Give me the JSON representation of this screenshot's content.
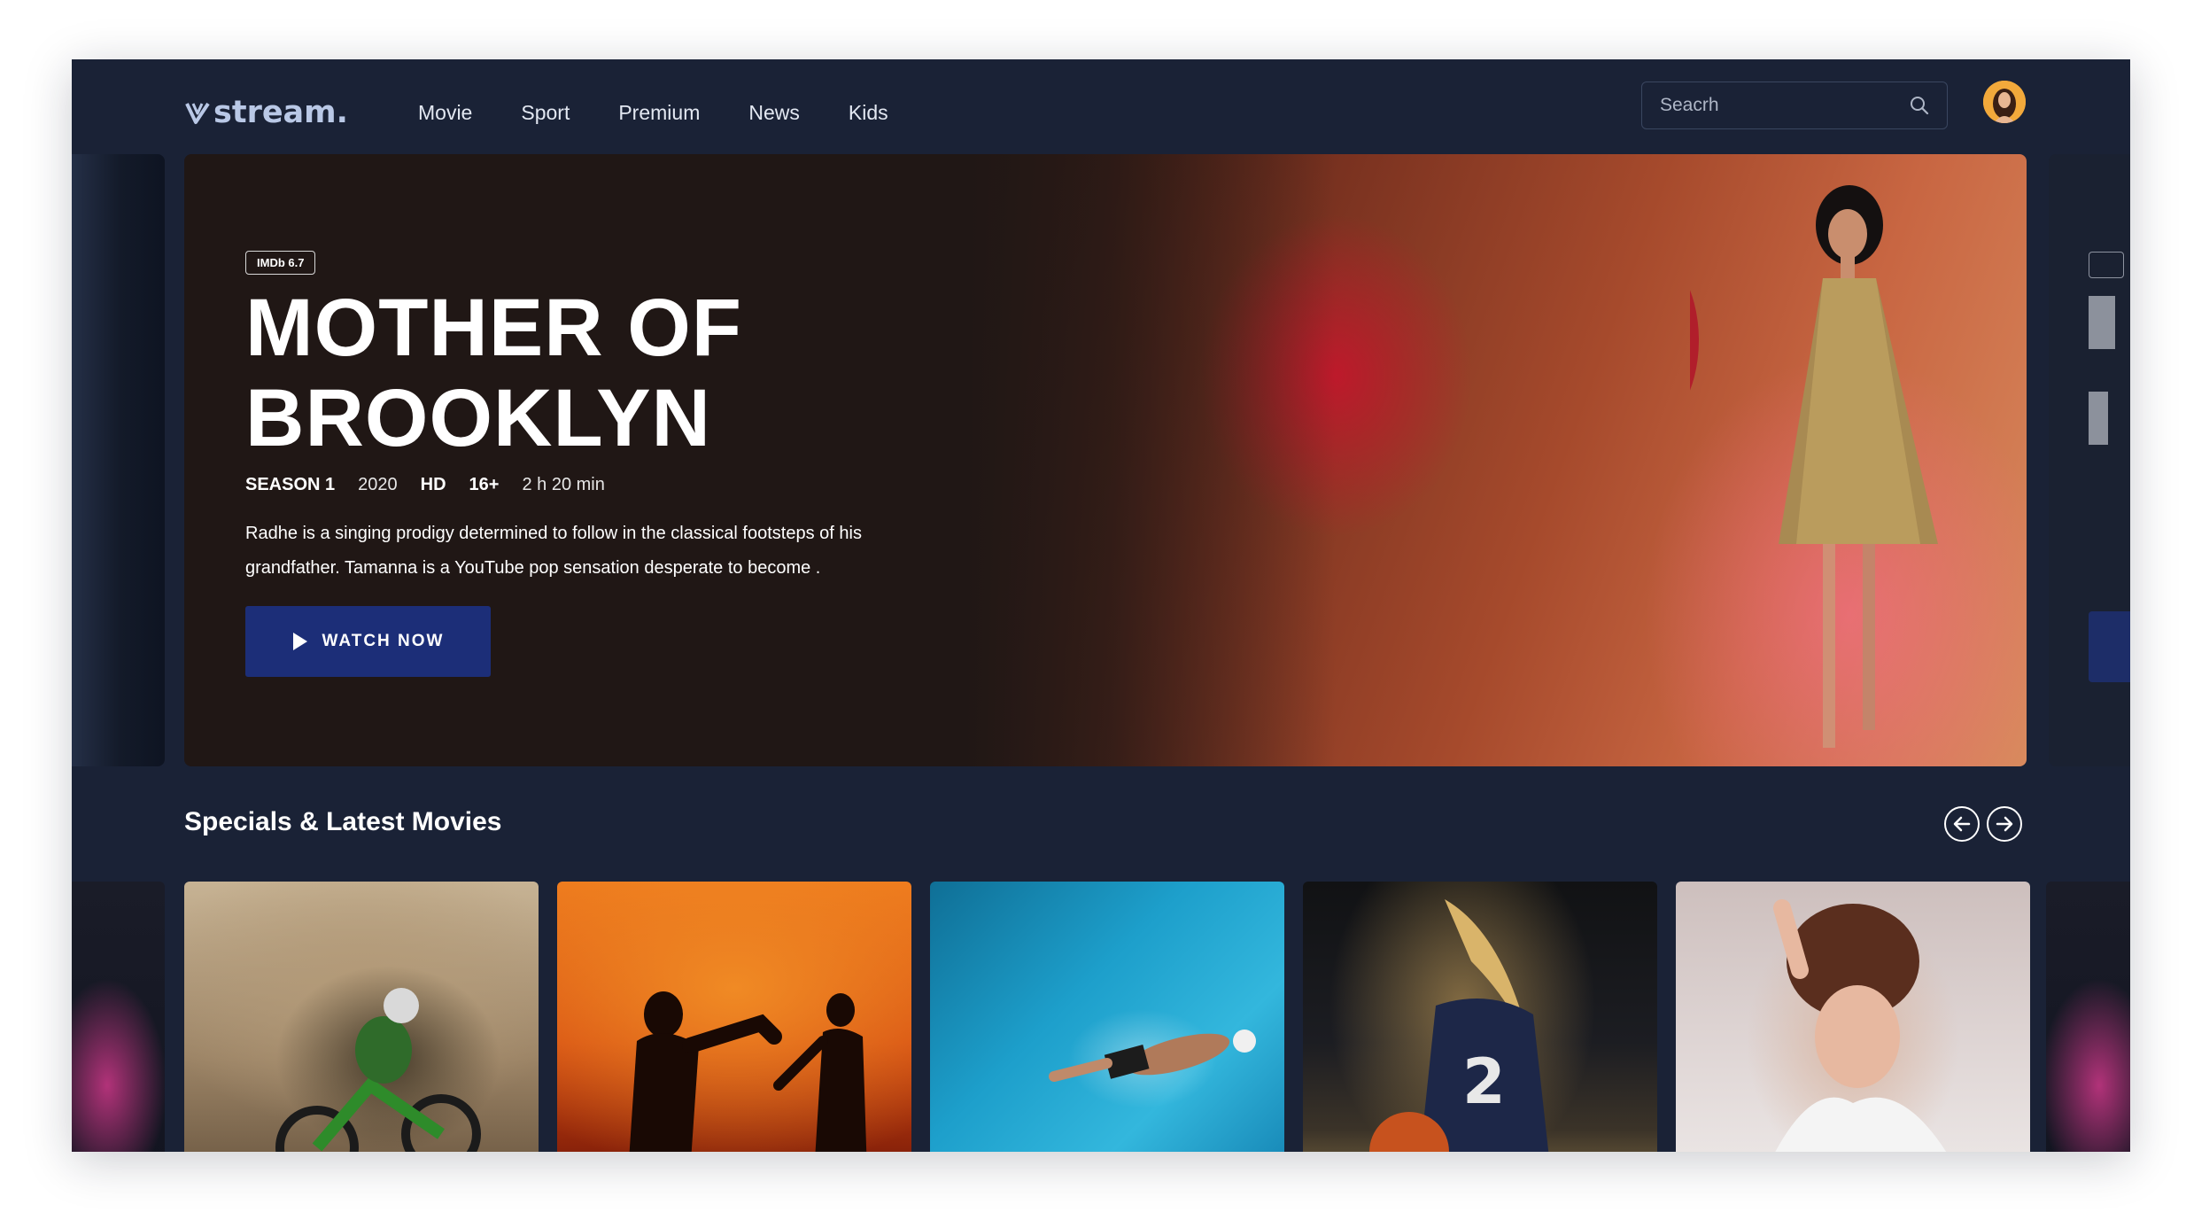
{
  "app": {
    "logo_text": "stream."
  },
  "nav": {
    "items": [
      {
        "label": "Movie"
      },
      {
        "label": "Sport"
      },
      {
        "label": "Premium"
      },
      {
        "label": "News"
      },
      {
        "label": "Kids"
      }
    ]
  },
  "search": {
    "placeholder": "Seacrh"
  },
  "hero": {
    "rating_badge": "IMDb 6.7",
    "title": "MOTHER OF BROOKLYN",
    "meta": {
      "season": "SEASON 1",
      "year": "2020",
      "quality": "HD",
      "age_rating": "16+",
      "duration": "2 h 20 min"
    },
    "description": "Radhe is a singing prodigy determined to follow in the classical footsteps of his grandfather. Tamanna is a YouTube pop sensation desperate to become .",
    "cta_label": "WATCH NOW"
  },
  "section": {
    "title": "Specials & Latest Movies"
  },
  "colors": {
    "background": "#1a2236",
    "accent_button": "#1c2e78",
    "logo": "#b9c8e6",
    "hero_panel": "#201715"
  },
  "icons": [
    "logo-v-icon",
    "search-icon",
    "play-icon",
    "arrow-left-icon",
    "arrow-right-icon"
  ]
}
